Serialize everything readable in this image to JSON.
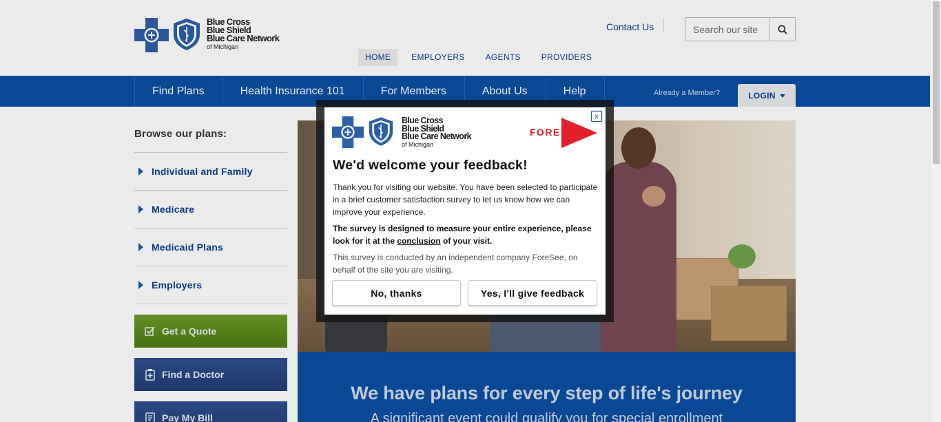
{
  "brand": {
    "line1": "Blue Cross",
    "line2": "Blue Shield",
    "line3": "Blue Care Network",
    "line4": "of Michigan"
  },
  "header": {
    "contact_label": "Contact Us",
    "search_placeholder": "Search our site",
    "subnav": [
      "HOME",
      "EMPLOYERS",
      "AGENTS",
      "PROVIDERS"
    ]
  },
  "mainnav": {
    "items": [
      "Find Plans",
      "Health Insurance 101",
      "For Members",
      "About Us",
      "Help"
    ],
    "member_question": "Already a Member?",
    "login_label": "LOGIN"
  },
  "sidebar": {
    "browse_label": "Browse our plans:",
    "plans": [
      "Individual and Family",
      "Medicare",
      "Medicaid Plans",
      "Employers"
    ],
    "quote_label": "Get a Quote",
    "doctor_label": "Find a Doctor",
    "bill_label": "Pay My Bill"
  },
  "banner": {
    "title": "We have plans for every step of life's journey",
    "subtitle": "A significant event could qualify you for special enrollment"
  },
  "survey": {
    "close_label": "x",
    "foresee_label": "FORESEE",
    "title": "We'd welcome your feedback!",
    "para1": "Thank you for visiting our website. You have been selected to participate in a brief customer satisfaction survey to let us know how we can improve your experience.",
    "para2_before": "The survey is designed to measure your entire experience, please look for it at the ",
    "para2_link": "conclusion",
    "para2_after": " of your visit.",
    "para3": "This survey is conducted by an independent company ForeSee, on behalf of the site you are visiting.",
    "no_label": "No, thanks",
    "yes_label": "Yes, I'll give feedback"
  },
  "colors": {
    "nav_blue": "#0b4ea2",
    "quote_green": "#5d8c1e",
    "doctor_blue": "#2a4784",
    "foresee_red": "#e2202a"
  }
}
